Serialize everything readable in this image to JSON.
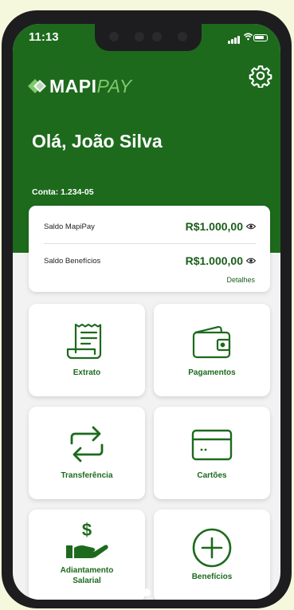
{
  "status_bar": {
    "time": "11:13"
  },
  "app": {
    "brand_part1": "MAPI",
    "brand_part2": "PAY"
  },
  "header": {
    "greeting": "Olá, João Silva",
    "account": "Conta:  1.234-05"
  },
  "balance": {
    "items": [
      {
        "label": "Saldo MapiPay",
        "value": "R$1.000,00"
      },
      {
        "label": "Saldo Benefícios",
        "value": "R$1.000,00"
      }
    ],
    "details_label": "Detalhes"
  },
  "tiles": [
    {
      "label": "Extrato",
      "icon": "receipt-icon"
    },
    {
      "label": "Pagamentos",
      "icon": "wallet-icon"
    },
    {
      "label": "Transferência",
      "icon": "transfer-arrows-icon"
    },
    {
      "label": "Cartões",
      "icon": "credit-card-icon"
    },
    {
      "label": "Adiantamento Salarial",
      "label_line1": "Adiantamento",
      "label_line2": "Salarial",
      "icon": "salary-advance-icon"
    },
    {
      "label": "Benefícios",
      "icon": "plus-circle-icon"
    }
  ],
  "colors": {
    "primary": "#1d6a1d",
    "accent": "#7fc96b",
    "background": "#f5f8dc"
  }
}
